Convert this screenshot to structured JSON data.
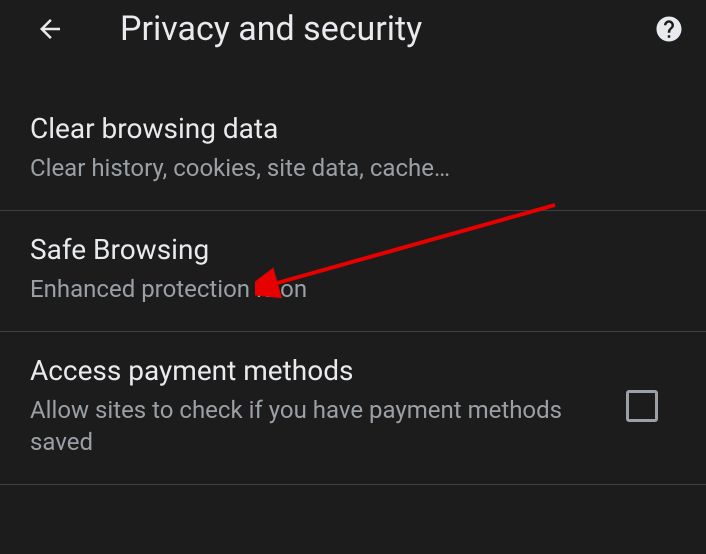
{
  "header": {
    "title": "Privacy and security"
  },
  "settings": {
    "clear_data": {
      "title": "Clear browsing data",
      "subtitle": "Clear history, cookies, site data, cache…"
    },
    "safe_browsing": {
      "title": "Safe Browsing",
      "subtitle": "Enhanced protection is on"
    },
    "payment": {
      "title": "Access payment methods",
      "subtitle": "Allow sites to check if you have payment methods saved"
    }
  }
}
